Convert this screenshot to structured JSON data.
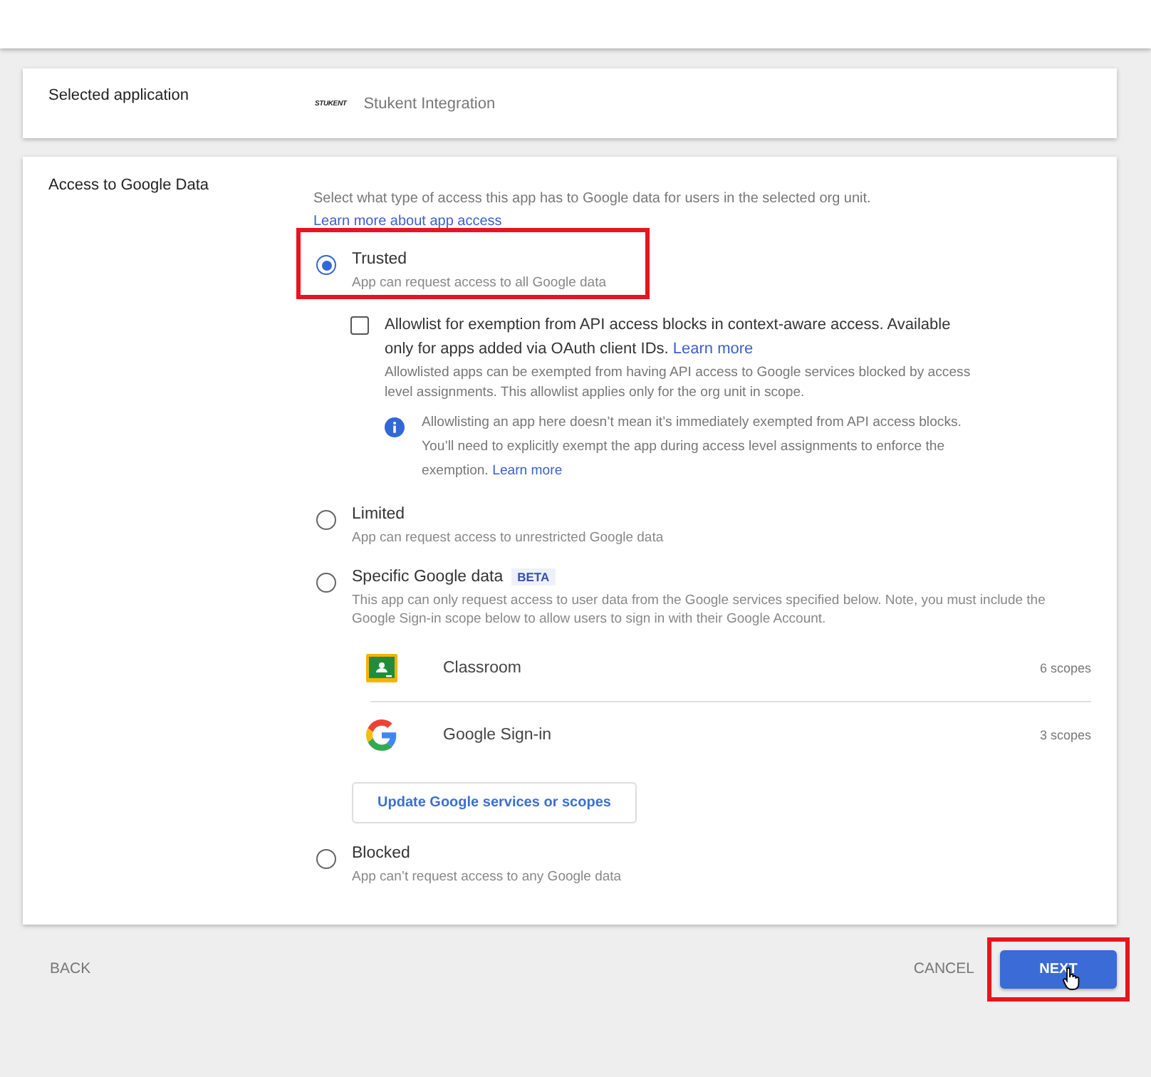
{
  "selected_application": {
    "label": "Selected application",
    "logo_text": "STUKENT",
    "app_name": "Stukent Integration"
  },
  "access": {
    "label": "Access to Google Data",
    "intro": "Select what type of access this app has to Google data for users in the selected org unit.",
    "learn_more": "Learn more about app access",
    "options": [
      {
        "label": "Trusted",
        "description": "App can request access to all Google data",
        "selected": true,
        "highlighted": true,
        "allowlist": {
          "checked": false,
          "title": "Allowlist for exemption from API access blocks in context-aware access. Available only for apps added via OAuth client IDs.",
          "title_link": "Learn more",
          "detail": "Allowlisted apps can be exempted from having API access to Google services blocked by access level assignments. This allowlist applies only for the org unit in scope.",
          "note": "Allowlisting an app here doesn’t mean it’s immediately exempted from API access blocks. You’ll need to explicitly exempt the app during access level assignments to enforce the exemption.",
          "note_link": "Learn more"
        }
      },
      {
        "label": "Limited",
        "description": "App can request access to unrestricted Google data",
        "selected": false,
        "highlighted": false
      },
      {
        "label": "Specific Google data",
        "badge": "BETA",
        "description": "This app can only request access to user data from the Google services specified below. Note, you must include the Google Sign-in scope below to allow users to sign in with their Google Account.",
        "selected": false,
        "highlighted": false,
        "services": [
          {
            "kind": "classroom",
            "name": "Classroom",
            "scopes": "6 scopes"
          },
          {
            "kind": "google",
            "name": "Google Sign-in",
            "scopes": "3 scopes"
          }
        ],
        "update_button": "Update Google services or scopes"
      },
      {
        "label": "Blocked",
        "description": "App can’t request access to any Google data",
        "selected": false,
        "highlighted": false
      }
    ]
  },
  "footer": {
    "back": "BACK",
    "cancel": "CANCEL",
    "next": "NEXT",
    "next_highlighted": true
  }
}
